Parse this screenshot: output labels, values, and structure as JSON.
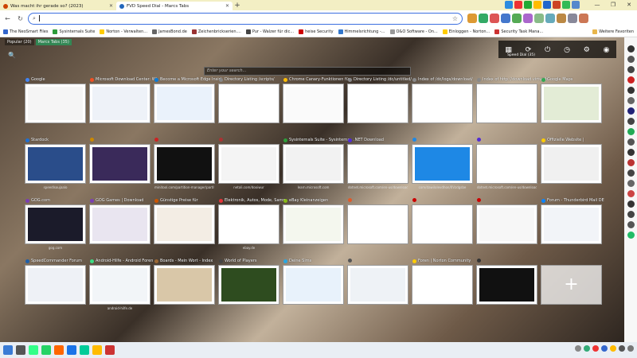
{
  "tabs": [
    {
      "label": "Was macht ihr gerade so? (2023)",
      "active": false,
      "color": "#cc4400"
    },
    {
      "label": "FVD Speed Dial - Marcs Tabs",
      "active": true,
      "color": "#2266bb"
    }
  ],
  "url": {
    "value": ""
  },
  "bookmarks": [
    {
      "label": "The NeoSmart Files",
      "color": "#3366cc"
    },
    {
      "label": "Sysinternals Suite",
      "color": "#2d9d3a"
    },
    {
      "label": "Norton - Verwalten...",
      "color": "#ffcc00"
    },
    {
      "label": "JamesBond.de",
      "color": "#666666"
    },
    {
      "label": "Zeichenbrickserien....",
      "color": "#993333"
    },
    {
      "label": "Pur - Walzer für dic...",
      "color": "#444444"
    },
    {
      "label": "heise Security",
      "color": "#cc0000"
    },
    {
      "label": "Himmelsrichtung -...",
      "color": "#3377cc"
    },
    {
      "label": "O&O Software - On...",
      "color": "#999999"
    },
    {
      "label": "Einloggen - Norton...",
      "color": "#ffcc00"
    },
    {
      "label": "Security Task Mana...",
      "color": "#cc3333"
    }
  ],
  "bookmarks_more": "Weitere Favoriten",
  "groups": [
    "Popular (20)",
    "Marcs Tabs (35)"
  ],
  "search_placeholder": "Enter your search...",
  "speed_dial_label": "Speed Dial (35)",
  "tiles": [
    {
      "title": "Google",
      "url": "",
      "ci": "#4285f4",
      "thumb": "#f5f5f5"
    },
    {
      "title": "Microsoft Download Center: Wi",
      "url": "",
      "ci": "#f25022",
      "thumb": "#eef2f8"
    },
    {
      "title": "Become a Microsoft Edge Insid",
      "url": "",
      "ci": "#0a7bd7",
      "thumb": "#eaf2fb"
    },
    {
      "title": "Directory Listing /scripts/",
      "url": "",
      "ci": "#888888",
      "thumb": "#ffffff"
    },
    {
      "title": "Chrome Canary-Funktionen für",
      "url": "",
      "ci": "#fbbc05",
      "thumb": "#fafafa"
    },
    {
      "title": "Directory Listing /dc/untitled/",
      "url": "",
      "ci": "#888888",
      "thumb": "#ffffff"
    },
    {
      "title": "Index of /dc/logs/download/",
      "url": "",
      "ci": "#888888",
      "thumb": "#ffffff"
    },
    {
      "title": "Index of http://download.virtualb",
      "url": "",
      "ci": "#888888",
      "thumb": "#ffffff"
    },
    {
      "title": "Google Maps",
      "url": "",
      "ci": "#34a853",
      "thumb": "#e3ecd6"
    },
    {
      "title": "Stardock",
      "url": "speedlsoujaalo",
      "ci": "#1f6fd1",
      "thumb": "#2a4d8a"
    },
    {
      "title": "",
      "url": "",
      "ci": "#cc8800",
      "thumb": "#3a2a5a"
    },
    {
      "title": "",
      "url": "minitool.com/partition-manager/partit",
      "ci": "#cc2222",
      "thumb": "#111111"
    },
    {
      "title": "",
      "url": "netali.com/dooiwur",
      "ci": "#aa3333",
      "thumb": "#f4f4f4"
    },
    {
      "title": "Sysinternals Suite - Sysinterna",
      "url": "learn.microsoft.com",
      "ci": "#2d9d3a",
      "thumb": "#f2f2f2"
    },
    {
      "title": ".NET Download",
      "url": "dotnet.microsoft.com/en-us/download",
      "ci": "#512bd4",
      "thumb": "#ffffff"
    },
    {
      "title": "",
      "url": "com/dawilolevdhon/0Vzdgsbe",
      "ci": "#1e88e5",
      "thumb": "#1e88e5"
    },
    {
      "title": "",
      "url": "dotnet.microsoft.com/en-us/download",
      "ci": "#512bd4",
      "thumb": "#ffffff"
    },
    {
      "title": "Offizielle Website |",
      "url": "",
      "ci": "#ffcc00",
      "thumb": "#f0f0f0"
    },
    {
      "title": "GOG.com",
      "url": "gog.com",
      "ci": "#7a3fb3",
      "thumb": "#1b1b2a"
    },
    {
      "title": "GOG Games | Download",
      "url": "",
      "ci": "#7a3fb3",
      "thumb": "#e9e5f0"
    },
    {
      "title": "Günstige Preise für",
      "url": "",
      "ci": "#cc5500",
      "thumb": "#f3ede4"
    },
    {
      "title": "Elektronik, Autos, Mode, Samm",
      "url": "ebay.de",
      "ci": "#e53238",
      "thumb": "#ffffff"
    },
    {
      "title": "eBay Kleinanzeigen",
      "url": "",
      "ci": "#86b817",
      "thumb": "#f4f7ee"
    },
    {
      "title": "",
      "url": "",
      "ci": "#e05a2a",
      "thumb": "#ffffff"
    },
    {
      "title": "",
      "url": "",
      "ci": "#cc0000",
      "thumb": "#ffffff"
    },
    {
      "title": "",
      "url": "",
      "ci": "#cc0000",
      "thumb": "#f7f7f7"
    },
    {
      "title": "Forum - Thunderbird Mail DE",
      "url": "",
      "ci": "#0a84ff",
      "thumb": "#f2f4f8"
    },
    {
      "title": "SpeedCommander Forum",
      "url": "",
      "ci": "#1f5fa8",
      "thumb": "#eef1f6"
    },
    {
      "title": "Android-Hilfe - Android Foren",
      "url": "android-hilfe.de",
      "ci": "#3ddc84",
      "thumb": "#f2f5f8"
    },
    {
      "title": "Boards - Mein Wort - Index",
      "url": "",
      "ci": "#996633",
      "thumb": "#d9c7a8"
    },
    {
      "title": "World of Players",
      "url": "",
      "ci": "#444444",
      "thumb": "#2e4c1f"
    },
    {
      "title": "Deine Sims",
      "url": "",
      "ci": "#2aa6e0",
      "thumb": "#e8f2fb"
    },
    {
      "title": "",
      "url": "",
      "ci": "#555555",
      "thumb": "#eef2f6"
    },
    {
      "title": "Foren | Norton Community",
      "url": "",
      "ci": "#ffcc00",
      "thumb": "#ffffff"
    },
    {
      "title": "",
      "url": "",
      "ci": "#333333",
      "thumb": "#111111"
    }
  ]
}
